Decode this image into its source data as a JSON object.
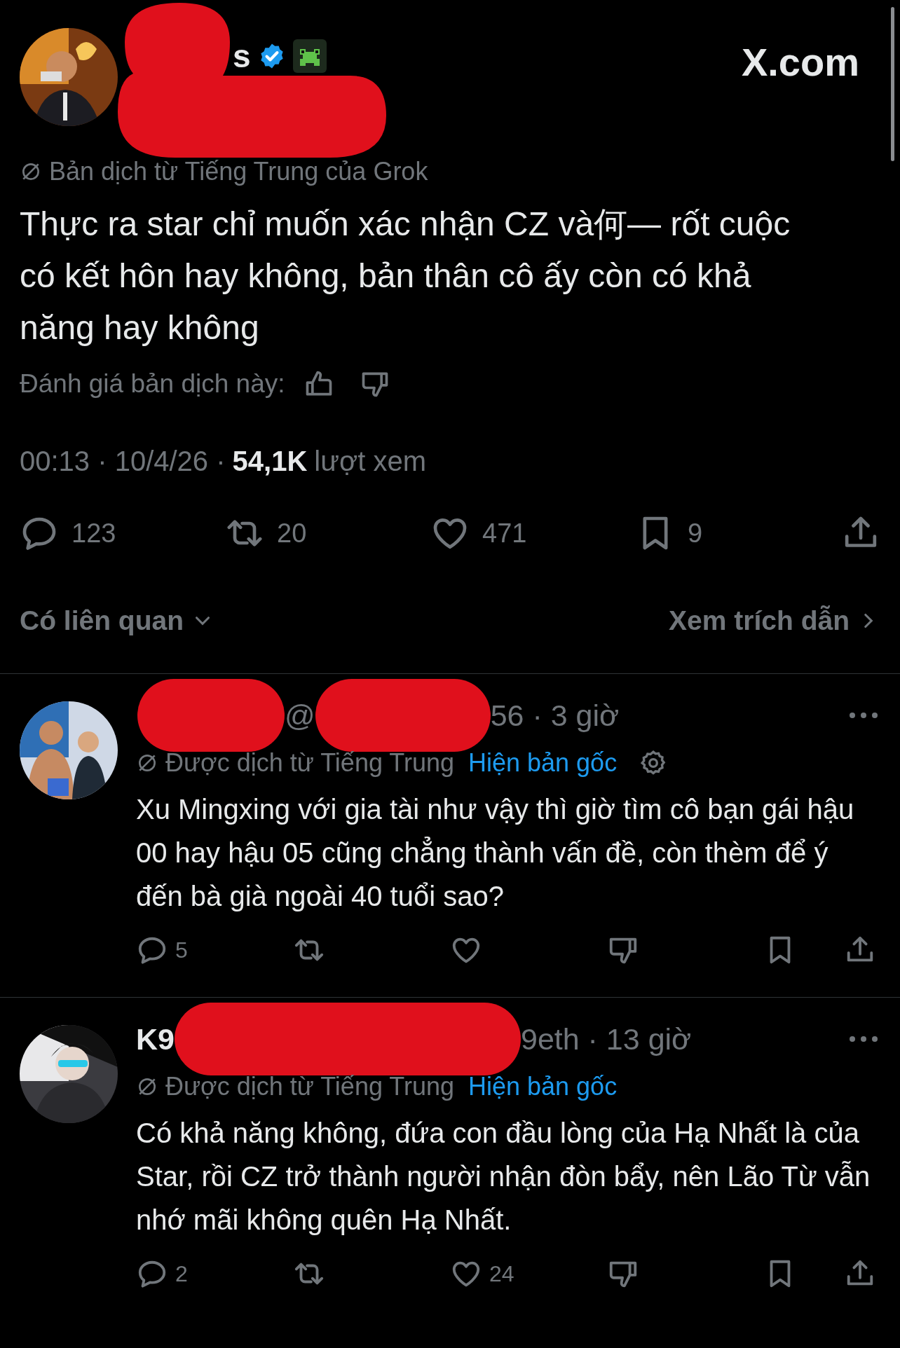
{
  "header": {
    "name_fragment": "s",
    "site": "X.com"
  },
  "post": {
    "translation_label": "Bản dịch từ Tiếng Trung của Grok",
    "text": "Thực ra star chỉ muốn xác nhận CZ và何— rốt cuộc có kết hôn hay không, bản thân cô ấy còn có khả năng hay không",
    "rate_label": "Đánh giá bản dịch này:",
    "time": "00:13 · 10/4/26 ·",
    "views_count": "54,1K",
    "views_label": "lượt xem",
    "actions": [
      {
        "kind": "reply",
        "count": "123"
      },
      {
        "kind": "repost",
        "count": "20"
      },
      {
        "kind": "like",
        "count": "471"
      },
      {
        "kind": "bookmark",
        "count": "9"
      },
      {
        "kind": "share"
      }
    ]
  },
  "related": {
    "label": "Có liên quan",
    "quotes": "Xem trích dẫn"
  },
  "replies": [
    {
      "name_redacted": true,
      "header_parts": [
        "@",
        "56 · 3 giờ"
      ],
      "translation_label": "Được dịch từ Tiếng Trung",
      "show_original": "Hiện bản gốc",
      "settings_icon": true,
      "text": "Xu Mingxing với gia tài như vậy thì giờ tìm cô bạn gái hậu 00 hay hậu 05 cũng chẳng thành vấn đề, còn thèm để ý đến bà già ngoài 40 tuổi sao?",
      "actions": [
        {
          "kind": "reply",
          "count": "5"
        },
        {
          "kind": "repost"
        },
        {
          "kind": "like"
        },
        {
          "kind": "dislike"
        },
        {
          "kind": "bookmark"
        },
        {
          "kind": "share"
        }
      ]
    },
    {
      "name_redacted": false,
      "header_parts": [
        "K9",
        "9eth · 13 giờ"
      ],
      "translation_label": "Được dịch từ Tiếng Trung",
      "show_original": "Hiện bản gốc",
      "settings_icon": false,
      "text": "Có khả năng không, đứa con đầu lòng của Hạ Nhất là của Star, rồi CZ trở thành người nhận đòn bẩy, nên Lão Từ vẫn nhớ mãi không quên Hạ Nhất.",
      "actions": [
        {
          "kind": "reply",
          "count": "2"
        },
        {
          "kind": "repost"
        },
        {
          "kind": "like",
          "count": "24"
        },
        {
          "kind": "dislike"
        },
        {
          "kind": "bookmark"
        },
        {
          "kind": "share"
        }
      ]
    }
  ]
}
